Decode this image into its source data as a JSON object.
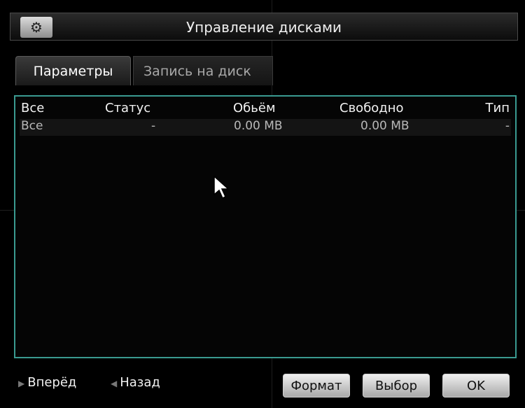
{
  "window": {
    "title": "Управление дисками",
    "icon": "hdd-settings-icon"
  },
  "tabs": [
    {
      "label": "Параметры",
      "active": true
    },
    {
      "label": "Запись на диск",
      "active": false
    }
  ],
  "table": {
    "columns": [
      "Все",
      "Статус",
      "Обьём",
      "Свободно",
      "Тип"
    ],
    "rows": [
      [
        "Все",
        "-",
        "0.00 MB",
        "0.00 MB",
        "-"
      ]
    ]
  },
  "footer": {
    "forward_label": "Вперёд",
    "back_label": "Назад",
    "format_label": "Формат",
    "select_label": "Выбор",
    "ok_label": "OK"
  },
  "colors": {
    "panel_border": "#3a9a90",
    "background": "#000000"
  }
}
